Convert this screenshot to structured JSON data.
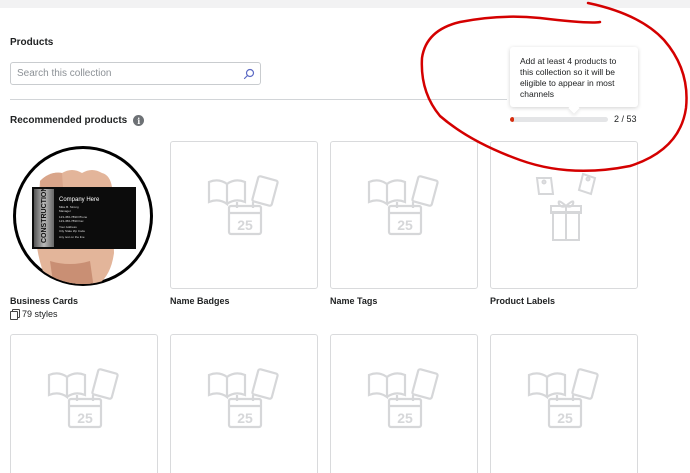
{
  "header": {
    "title": "Products"
  },
  "search": {
    "placeholder": "Search this collection",
    "value": ""
  },
  "recommended": {
    "title": "Recommended products",
    "info_icon": "info-icon"
  },
  "tooltip": {
    "text": "Add at least 4 products to this collection so it will be eligible to appear in most channels"
  },
  "progress": {
    "current": 2,
    "total": 53,
    "label": "2 / 53",
    "fill_color": "#d72c0d"
  },
  "annotation": {
    "color": "#d40000",
    "shape": "hand-drawn circle around tooltip and progress"
  },
  "business_card_image": {
    "company": "Company Here",
    "name": "Mike B. Strong",
    "title": "Manager",
    "phone": "123-456-7890 Phone",
    "fax": "123-456-7890 Fax",
    "address": "Your Address",
    "city": "City State Zip Code",
    "tagline": "Any text on the line",
    "side_text": "CONSTRUCTION"
  },
  "products": [
    {
      "name": "Business Cards",
      "styles": "79 styles",
      "image": "business-card-photo"
    },
    {
      "name": "Name Badges",
      "image": "placeholder-icon"
    },
    {
      "name": "Name Tags",
      "image": "placeholder-icon"
    },
    {
      "name": "Product Labels",
      "image": "gift-tags-icon"
    },
    {
      "name": "",
      "image": "placeholder-icon"
    },
    {
      "name": "",
      "image": "placeholder-icon"
    },
    {
      "name": "",
      "image": "placeholder-icon"
    },
    {
      "name": "",
      "image": "placeholder-icon"
    }
  ],
  "placeholder_day": "25"
}
